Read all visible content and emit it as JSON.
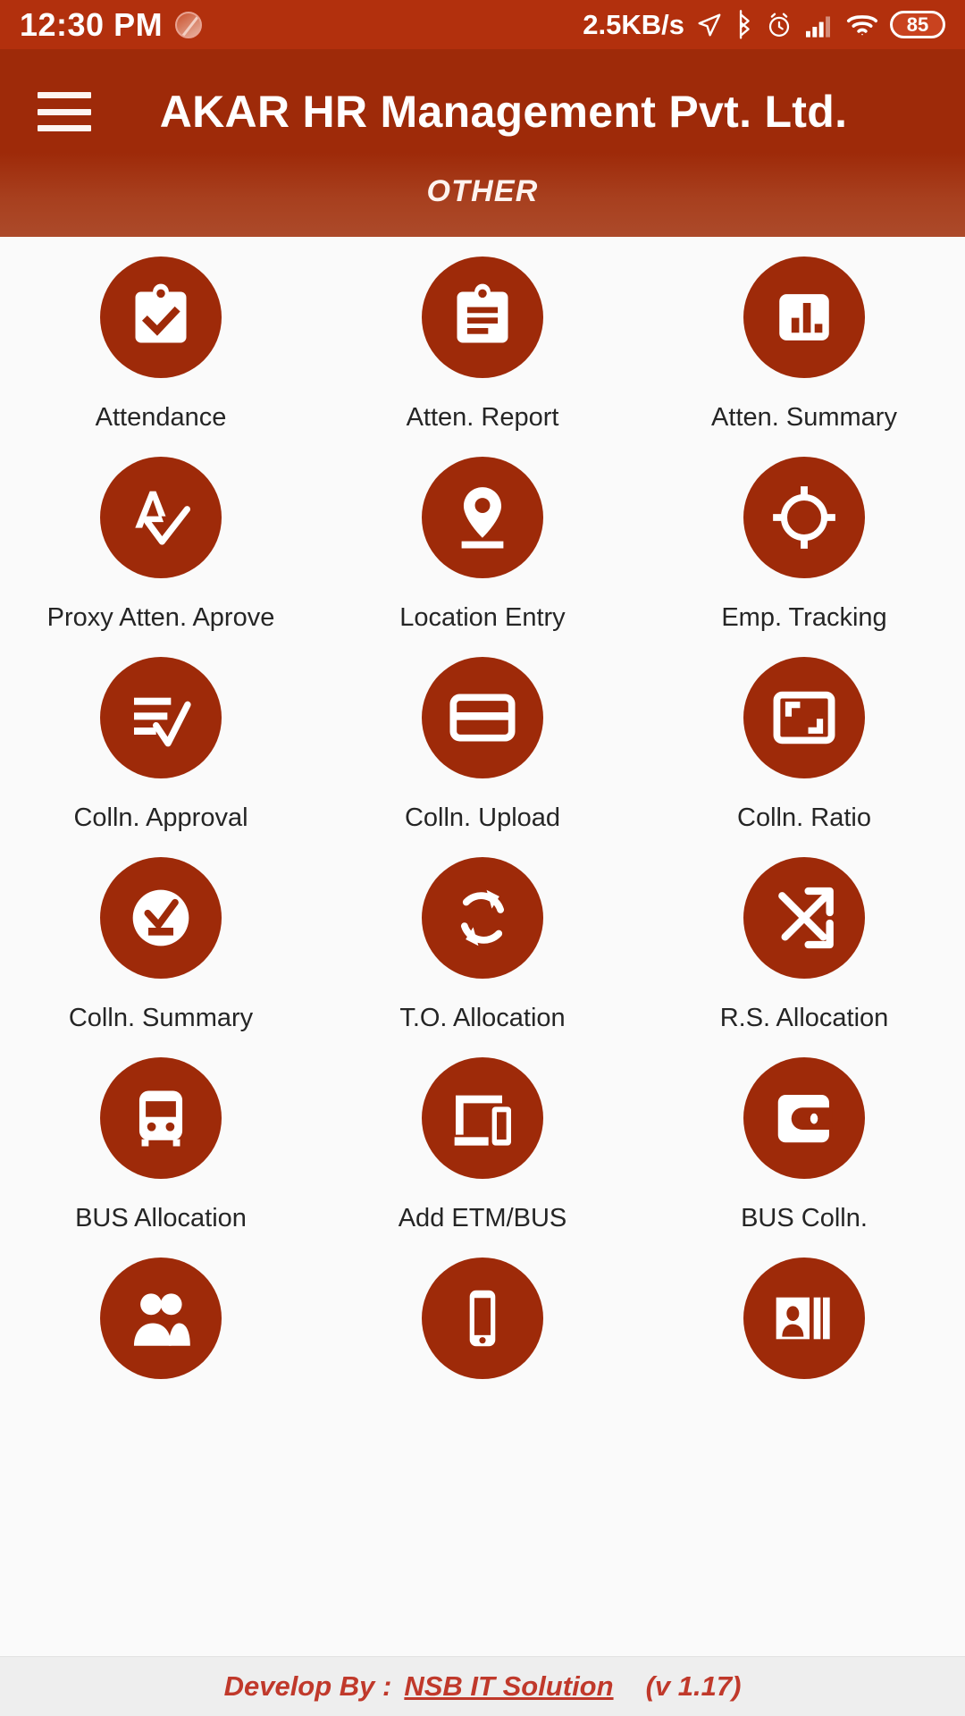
{
  "status_bar": {
    "clock": "12:30 PM",
    "mute_icon": "mute-icon",
    "net_speed": "2.5KB/s",
    "location_icon": "location-arrow-icon",
    "bluetooth_icon": "bluetooth-icon",
    "alarm_icon": "alarm-clock-icon",
    "signal_icon": "cellular-signal-icon",
    "wifi_icon": "wifi-icon",
    "battery_level": "85"
  },
  "app_bar": {
    "menu_icon": "hamburger-menu-icon",
    "title": "AKAR HR Management Pvt. Ltd.",
    "tabs": [
      {
        "label": "OTHER",
        "active": true
      }
    ]
  },
  "grid": {
    "items": [
      {
        "label": "Attendance",
        "icon": "clipboard-check-icon"
      },
      {
        "label": "Atten. Report",
        "icon": "clipboard-list-icon"
      },
      {
        "label": "Atten. Summary",
        "icon": "bar-chart-icon"
      },
      {
        "label": "Proxy Atten. Aprove",
        "icon": "letter-a-check-icon"
      },
      {
        "label": "Location Entry",
        "icon": "map-pin-icon"
      },
      {
        "label": "Emp. Tracking",
        "icon": "crosshair-target-icon"
      },
      {
        "label": "Colln. Approval",
        "icon": "list-check-icon"
      },
      {
        "label": "Colln. Upload",
        "icon": "credit-card-icon"
      },
      {
        "label": "Colln. Ratio",
        "icon": "resize-frame-icon"
      },
      {
        "label": "Colln. Summary",
        "icon": "circle-check-minus-icon"
      },
      {
        "label": "T.O. Allocation",
        "icon": "refresh-sync-icon"
      },
      {
        "label": "R.S. Allocation",
        "icon": "shuffle-arrows-icon"
      },
      {
        "label": "BUS Allocation",
        "icon": "bus-front-icon"
      },
      {
        "label": "Add ETM/BUS",
        "icon": "devices-tablet-phone-icon"
      },
      {
        "label": "BUS Colln.",
        "icon": "wallet-coin-icon"
      },
      {
        "label": "",
        "icon": "two-people-icon"
      },
      {
        "label": "",
        "icon": "mobile-phone-icon"
      },
      {
        "label": "",
        "icon": "id-card-icon"
      }
    ]
  },
  "footer": {
    "prefix": "Develop By :",
    "link": "NSB IT Solution",
    "version": "(v 1.17)"
  },
  "colors": {
    "brand": "#9e2a09",
    "status_bar": "#b2300d",
    "page_bg": "#fafafa",
    "footer_bg": "#eeeeee",
    "footer_text": "#c0392b",
    "label_text": "#252525"
  }
}
